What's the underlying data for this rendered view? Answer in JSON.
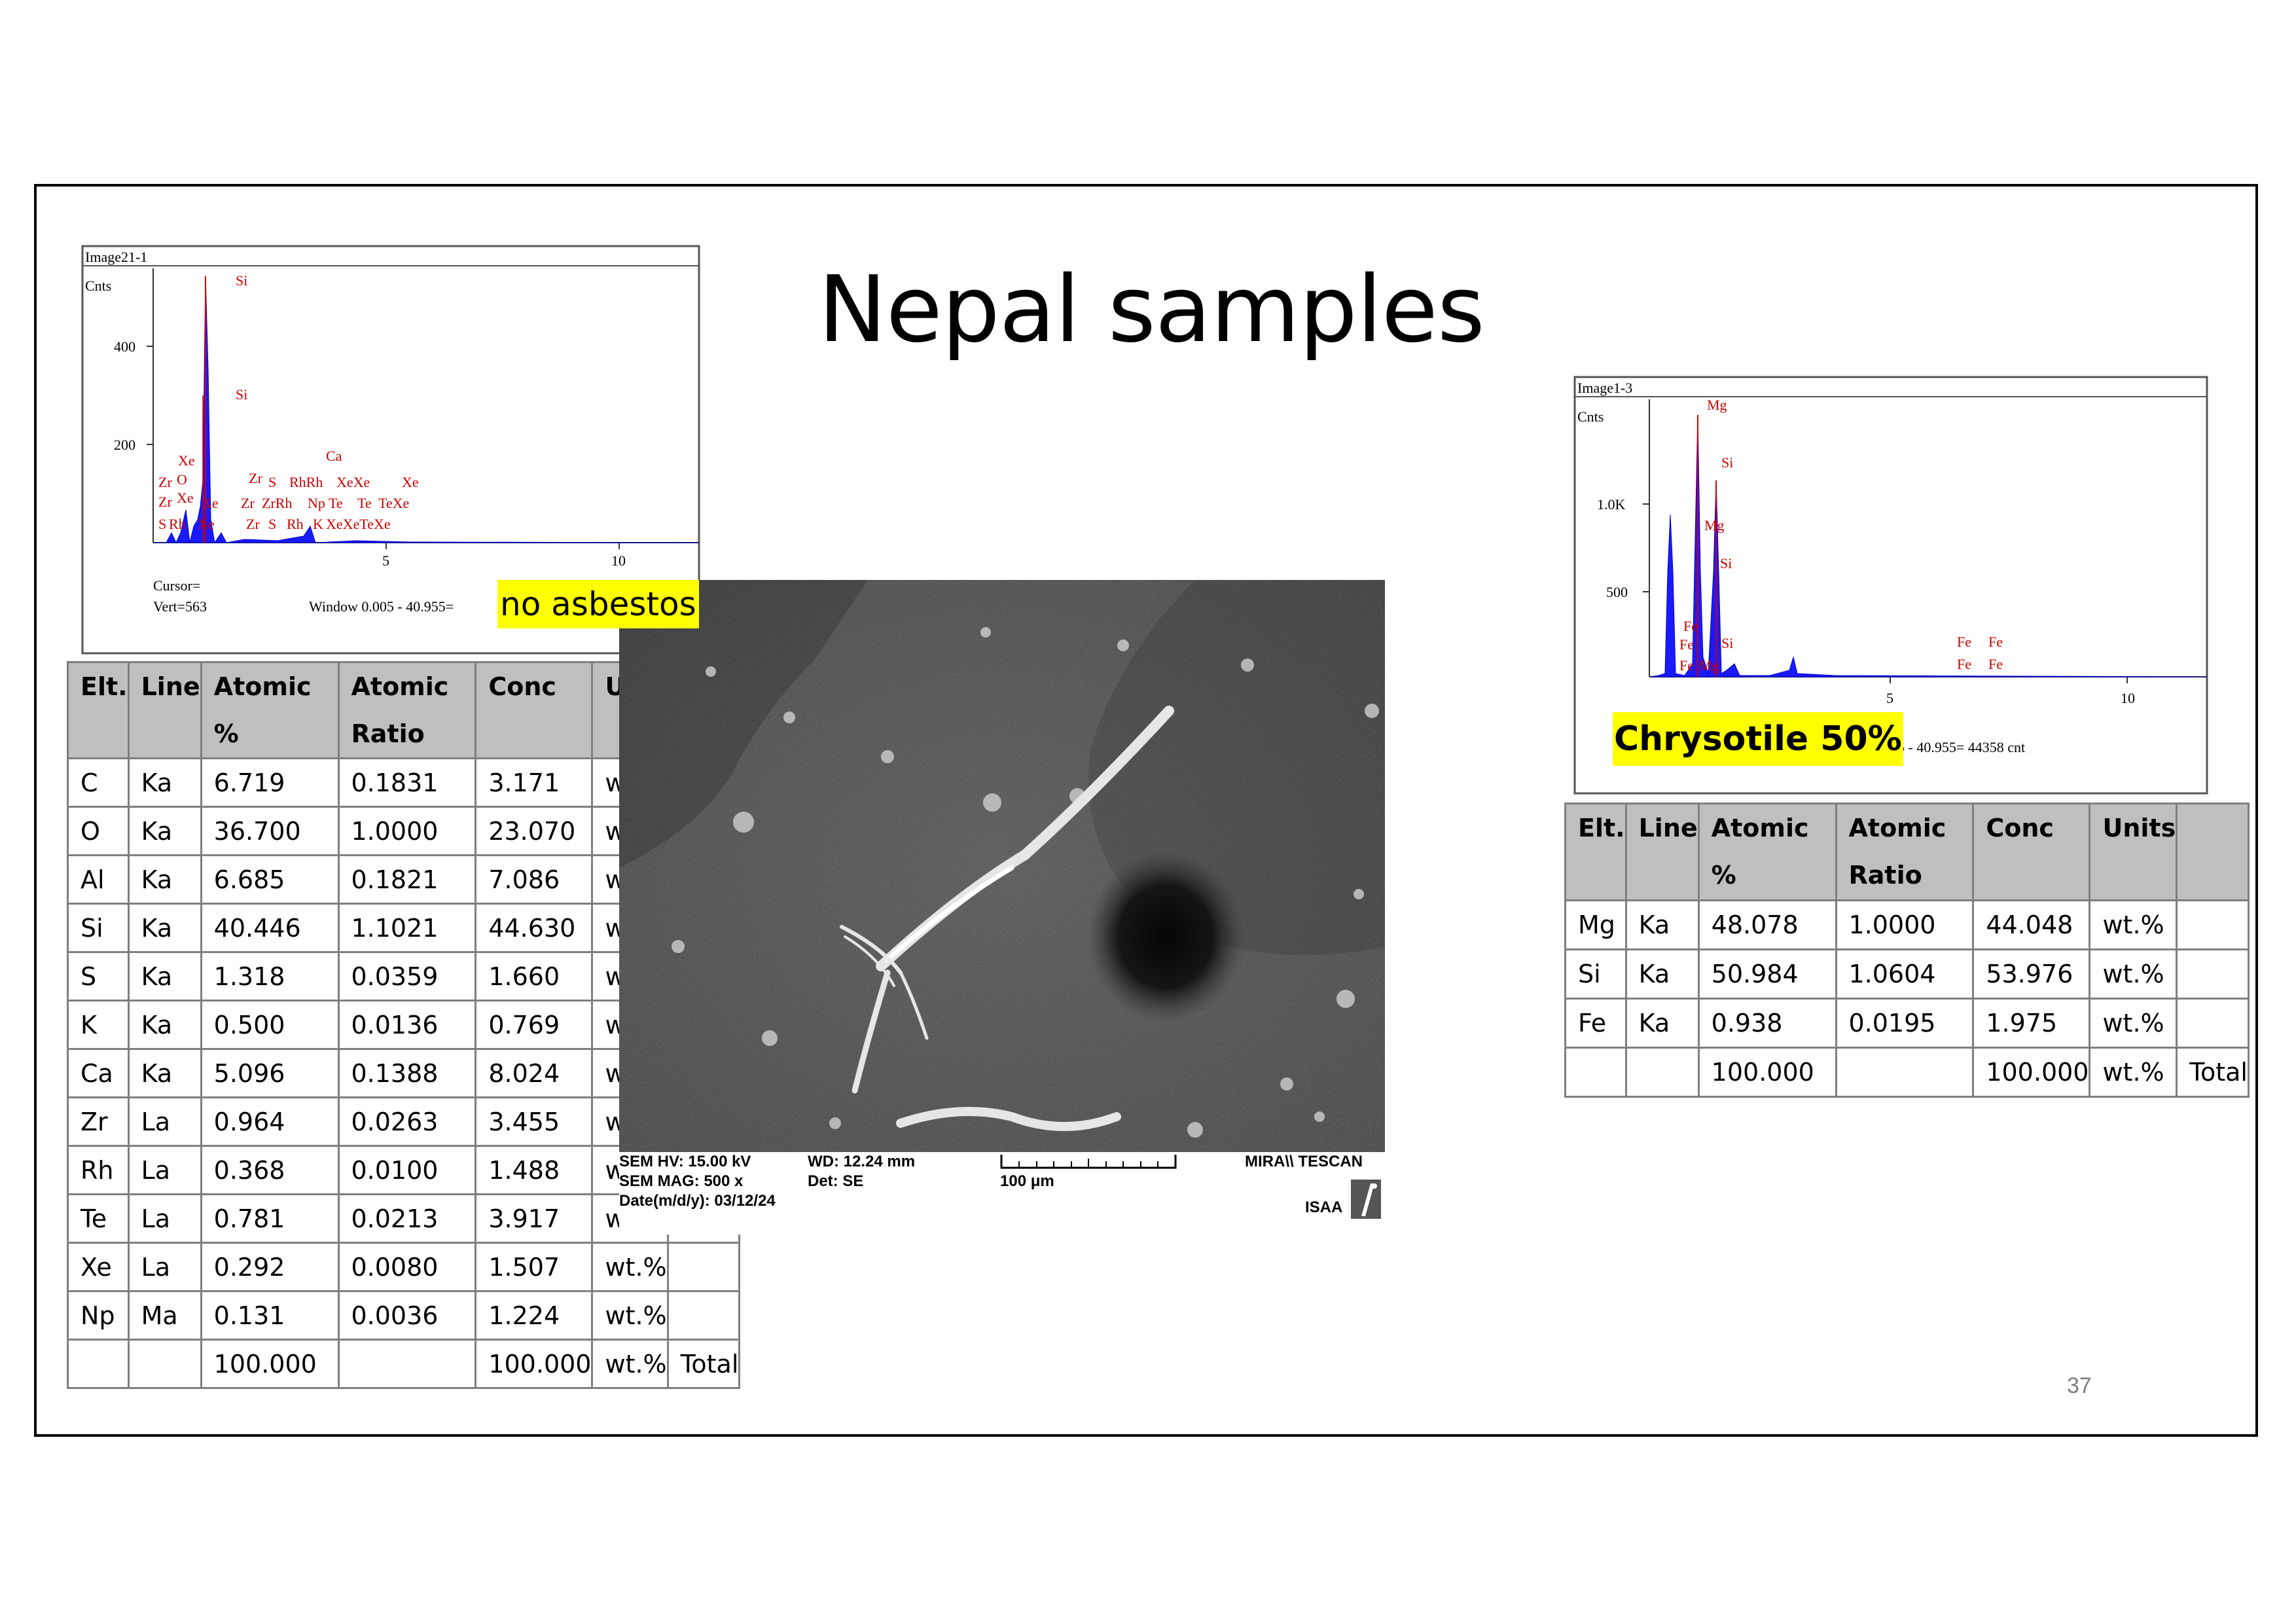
{
  "slide": {
    "title": "Nepal samples",
    "page_number": "37"
  },
  "spectrum_left": {
    "image_label": "Image21-1",
    "y_axis_label": "Cnts",
    "y_ticks": [
      "400",
      "200"
    ],
    "x_ticks": [
      "5",
      "10"
    ],
    "peak_labels": [
      "Si",
      "Si",
      "Ca",
      "Xe",
      "Zr",
      "O",
      "Zr",
      "S",
      "RhRh",
      "XeXe",
      "Xe",
      "Zr",
      "Xe",
      "Xe",
      "Zr",
      "ZrRh",
      "Np",
      "Te",
      "Te",
      "TeXe",
      "S",
      "Rh",
      "Xe",
      "Zr",
      "S",
      "Rh",
      "K",
      "XeXeTeXe"
    ],
    "cursor_label": "Cursor=",
    "vert_label": "Vert=563",
    "window_label": "Window 0.005 - 40.955="
  },
  "spectrum_right": {
    "image_label": "Image1-3",
    "y_axis_label": "Cnts",
    "y_ticks": [
      "1.0K",
      "500"
    ],
    "x_ticks": [
      "5",
      "10"
    ],
    "peak_labels": [
      "Mg",
      "Si",
      "Mg",
      "Si",
      "Fe",
      "Fe",
      "Fe",
      "Mg",
      "Si",
      "Fe",
      "Fe",
      "Fe",
      "Fe"
    ],
    "window_label": "v 0.005 - 40.955=   44358 cnt"
  },
  "highlights": {
    "left": "no asbestos",
    "right": "Chrysotile 50%"
  },
  "table_left": {
    "headers": [
      "Elt.",
      "Line",
      "Atomic %",
      "Atomic Ratio",
      "Conc",
      "Uni"
    ],
    "rows": [
      [
        "C",
        "Ka",
        "6.719",
        "0.1831",
        "3.171",
        "wt.%",
        ""
      ],
      [
        "O",
        "Ka",
        "36.700",
        "1.0000",
        "23.070",
        "wt.%",
        ""
      ],
      [
        "Al",
        "Ka",
        "6.685",
        "0.1821",
        "7.086",
        "wt.%",
        ""
      ],
      [
        "Si",
        "Ka",
        "40.446",
        "1.1021",
        "44.630",
        "wt.%",
        ""
      ],
      [
        "S",
        "Ka",
        "1.318",
        "0.0359",
        "1.660",
        "wt.%",
        ""
      ],
      [
        "K",
        "Ka",
        "0.500",
        "0.0136",
        "0.769",
        "wt.%",
        ""
      ],
      [
        "Ca",
        "Ka",
        "5.096",
        "0.1388",
        "8.024",
        "wt.%",
        ""
      ],
      [
        "Zr",
        "La",
        "0.964",
        "0.0263",
        "3.455",
        "wt.%",
        ""
      ],
      [
        "Rh",
        "La",
        "0.368",
        "0.0100",
        "1.488",
        "wt.%",
        ""
      ],
      [
        "Te",
        "La",
        "0.781",
        "0.0213",
        "3.917",
        "wt.%",
        ""
      ],
      [
        "Xe",
        "La",
        "0.292",
        "0.0080",
        "1.507",
        "wt.%",
        ""
      ],
      [
        "Np",
        "Ma",
        "0.131",
        "0.0036",
        "1.224",
        "wt.%",
        ""
      ],
      [
        "",
        "",
        "100.000",
        "",
        "100.000",
        "wt.%",
        "Total"
      ]
    ]
  },
  "table_right": {
    "headers": [
      "Elt.",
      "Line",
      "Atomic %",
      "Atomic Ratio",
      "Conc",
      "Units",
      ""
    ],
    "rows": [
      [
        "Mg",
        "Ka",
        "48.078",
        "1.0000",
        "44.048",
        "wt.%",
        ""
      ],
      [
        "Si",
        "Ka",
        "50.984",
        "1.0604",
        "53.976",
        "wt.%",
        ""
      ],
      [
        "Fe",
        "Ka",
        "0.938",
        "0.0195",
        "1.975",
        "wt.%",
        ""
      ],
      [
        "",
        "",
        "100.000",
        "",
        "100.000",
        "wt.%",
        "Total"
      ]
    ]
  },
  "sem": {
    "hv": "SEM HV: 15.00 kV",
    "wd": "WD: 12.24 mm",
    "mag": "SEM MAG: 500 x",
    "det": "Det: SE",
    "date": "Date(m/d/y): 03/12/24",
    "scale": "100 μm",
    "brand": "MIRA\\\\ TESCAN",
    "lab": "ISAA"
  }
}
